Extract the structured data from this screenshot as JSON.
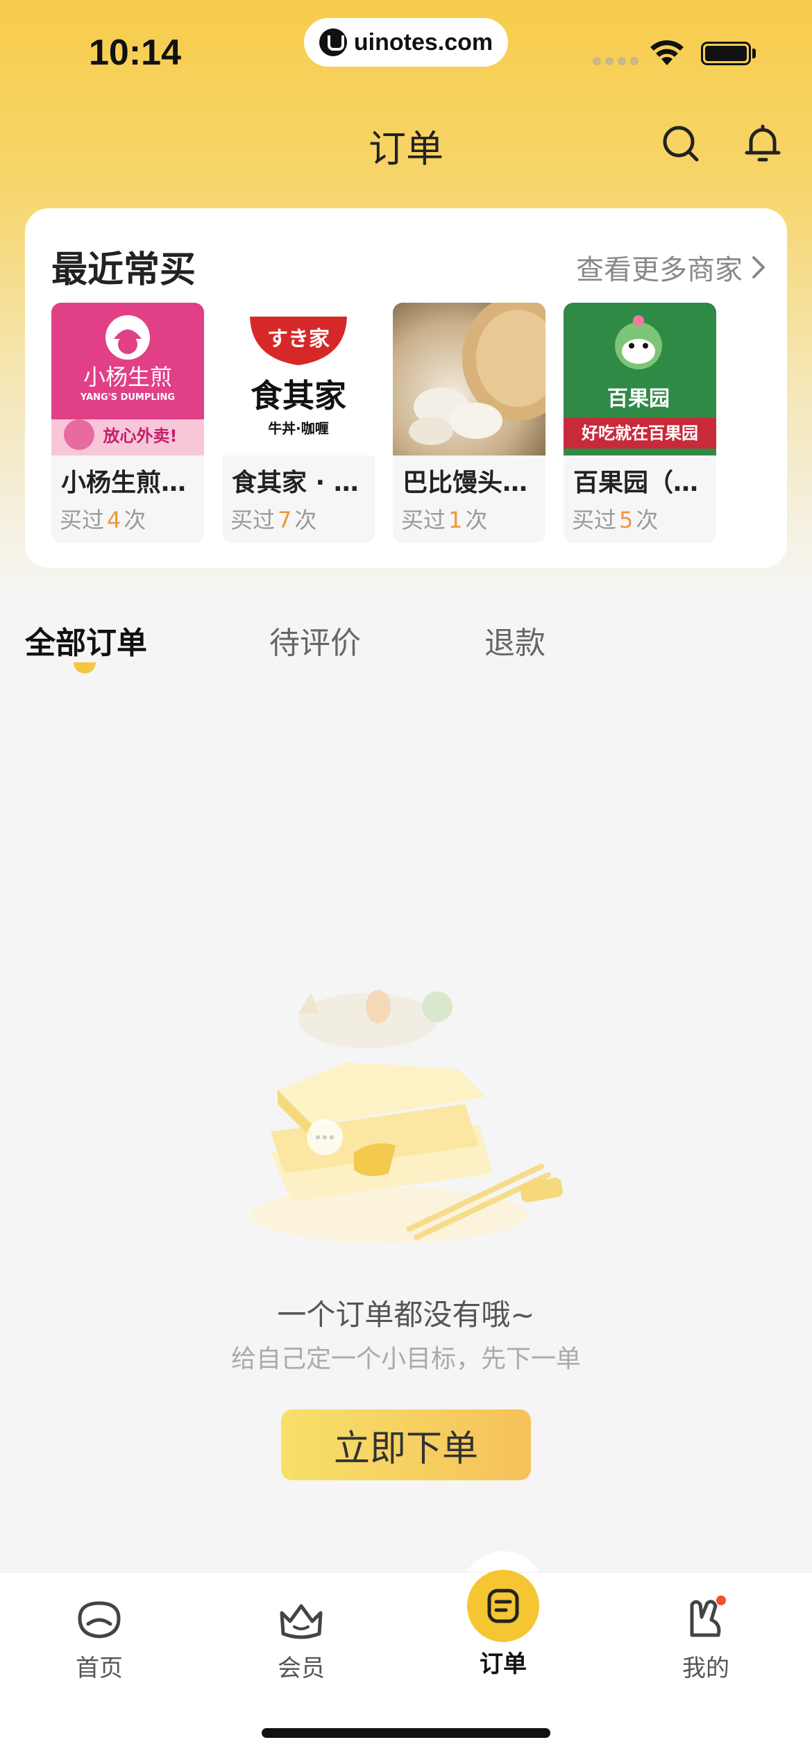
{
  "status_bar": {
    "time": "10:14",
    "url": "uinotes.com"
  },
  "nav": {
    "title": "订单",
    "icons": [
      "search-icon",
      "bell-icon"
    ]
  },
  "recent": {
    "title": "最近常买",
    "more_label": "查看更多商家",
    "shops": [
      {
        "name": "小杨生煎…",
        "count_prefix": "买过",
        "count": "4",
        "count_suffix": "次",
        "logo_text": "小杨生煎",
        "logo_sub": "YANG'S DUMPLING",
        "banner": "放心外卖!"
      },
      {
        "name": "食其家 · …",
        "count_prefix": "买过",
        "count": "7",
        "count_suffix": "次",
        "logo_text": "食其家",
        "logo_sub": "牛丼·咖喱",
        "logo_top": "すき家"
      },
      {
        "name": "巴比馒头…",
        "count_prefix": "买过",
        "count": "1",
        "count_suffix": "次"
      },
      {
        "name": "百果园（…",
        "count_prefix": "买过",
        "count": "5",
        "count_suffix": "次",
        "logo_text": "百果园",
        "banner": "好吃就在百果园"
      }
    ]
  },
  "tabs": {
    "all": "全部订单",
    "review": "待评价",
    "refund": "退款"
  },
  "empty": {
    "title": "一个订单都没有哦~",
    "subtitle": "给自己定一个小目标，先下一单",
    "button": "立即下单"
  },
  "tabbar": {
    "home": "首页",
    "member": "会员",
    "orders": "订单",
    "mine": "我的"
  },
  "colors": {
    "accent": "#f5c632",
    "count": "#f0963a"
  }
}
